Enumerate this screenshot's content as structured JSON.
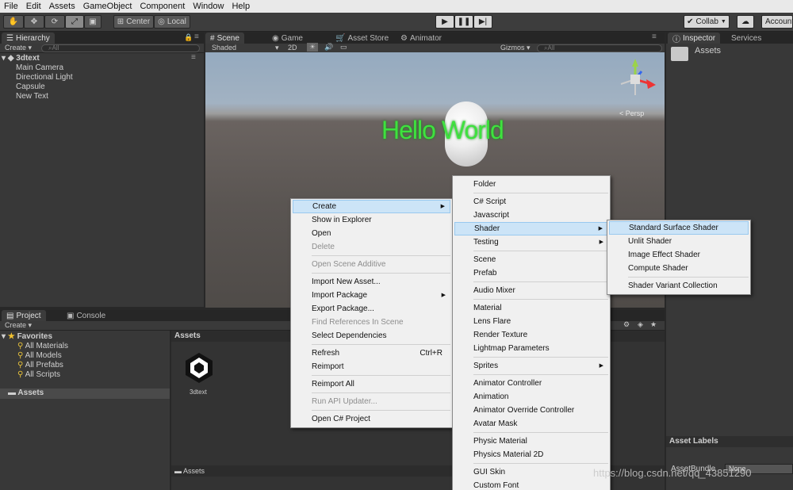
{
  "menubar": [
    "File",
    "Edit",
    "Assets",
    "GameObject",
    "Component",
    "Window",
    "Help"
  ],
  "toolbar": {
    "center_label": "Center",
    "local_label": "Local",
    "collab_label": "Collab",
    "account_label": "Account"
  },
  "hierarchy": {
    "tab": "Hierarchy",
    "create": "Create",
    "search_placeholder": "All",
    "scene_name": "3dtext",
    "items": [
      "Main Camera",
      "Directional Light",
      "Capsule",
      "New Text"
    ]
  },
  "scene_tabs": {
    "scene": "Scene",
    "game": "Game",
    "asset_store": "Asset Store",
    "animator": "Animator"
  },
  "scene_bar": {
    "shaded": "Shaded",
    "mode_2d": "2D",
    "gizmos": "Gizmos",
    "search": "All"
  },
  "scene": {
    "text3d": "Hello World",
    "persp": "Persp"
  },
  "inspector": {
    "tab": "Inspector",
    "services": "Services",
    "title": "Assets",
    "labels_header": "Asset Labels",
    "asset_bundle": "AssetBundle",
    "bundle_value": "None"
  },
  "project": {
    "tab": "Project",
    "console": "Console",
    "create": "Create",
    "favorites": "Favorites",
    "fav_items": [
      "All Materials",
      "All Models",
      "All Prefabs",
      "All Scripts"
    ],
    "assets_root": "Assets",
    "assets_header": "Assets",
    "asset_name": "3dtext",
    "footer_path": "Assets"
  },
  "menu1": {
    "items": [
      {
        "label": "Create",
        "arrow": true,
        "hl": true
      },
      {
        "label": "Show in Explorer"
      },
      {
        "label": "Open"
      },
      {
        "label": "Delete",
        "disabled": true
      },
      {
        "label": "Open Scene Additive",
        "disabled": true
      },
      {
        "label": "Import New Asset..."
      },
      {
        "label": "Import Package",
        "arrow": true
      },
      {
        "label": "Export Package..."
      },
      {
        "label": "Find References In Scene",
        "disabled": true
      },
      {
        "label": "Select Dependencies"
      },
      {
        "label": "Refresh",
        "shortcut": "Ctrl+R"
      },
      {
        "label": "Reimport"
      },
      {
        "label": "Reimport All"
      },
      {
        "label": "Run API Updater...",
        "disabled": true
      },
      {
        "label": "Open C# Project"
      }
    ]
  },
  "menu2": {
    "items": [
      {
        "label": "Folder"
      },
      {
        "label": "C# Script"
      },
      {
        "label": "Javascript"
      },
      {
        "label": "Shader",
        "arrow": true,
        "hl": true
      },
      {
        "label": "Testing",
        "arrow": true
      },
      {
        "label": "Scene"
      },
      {
        "label": "Prefab"
      },
      {
        "label": "Audio Mixer"
      },
      {
        "label": "Material"
      },
      {
        "label": "Lens Flare"
      },
      {
        "label": "Render Texture"
      },
      {
        "label": "Lightmap Parameters"
      },
      {
        "label": "Sprites",
        "arrow": true
      },
      {
        "label": "Animator Controller"
      },
      {
        "label": "Animation"
      },
      {
        "label": "Animator Override Controller"
      },
      {
        "label": "Avatar Mask"
      },
      {
        "label": "Physic Material"
      },
      {
        "label": "Physics Material 2D"
      },
      {
        "label": "GUI Skin"
      },
      {
        "label": "Custom Font"
      }
    ]
  },
  "menu3": {
    "items": [
      {
        "label": "Standard Surface Shader",
        "hl": true
      },
      {
        "label": "Unlit Shader"
      },
      {
        "label": "Image Effect Shader"
      },
      {
        "label": "Compute Shader"
      },
      {
        "label": "Shader Variant Collection"
      }
    ]
  },
  "watermark": "https://blog.csdn.net/qq_43851290",
  "colors": {
    "text3d": "#3ee23e",
    "highlight": "#cce4f7",
    "panel": "#383838"
  }
}
